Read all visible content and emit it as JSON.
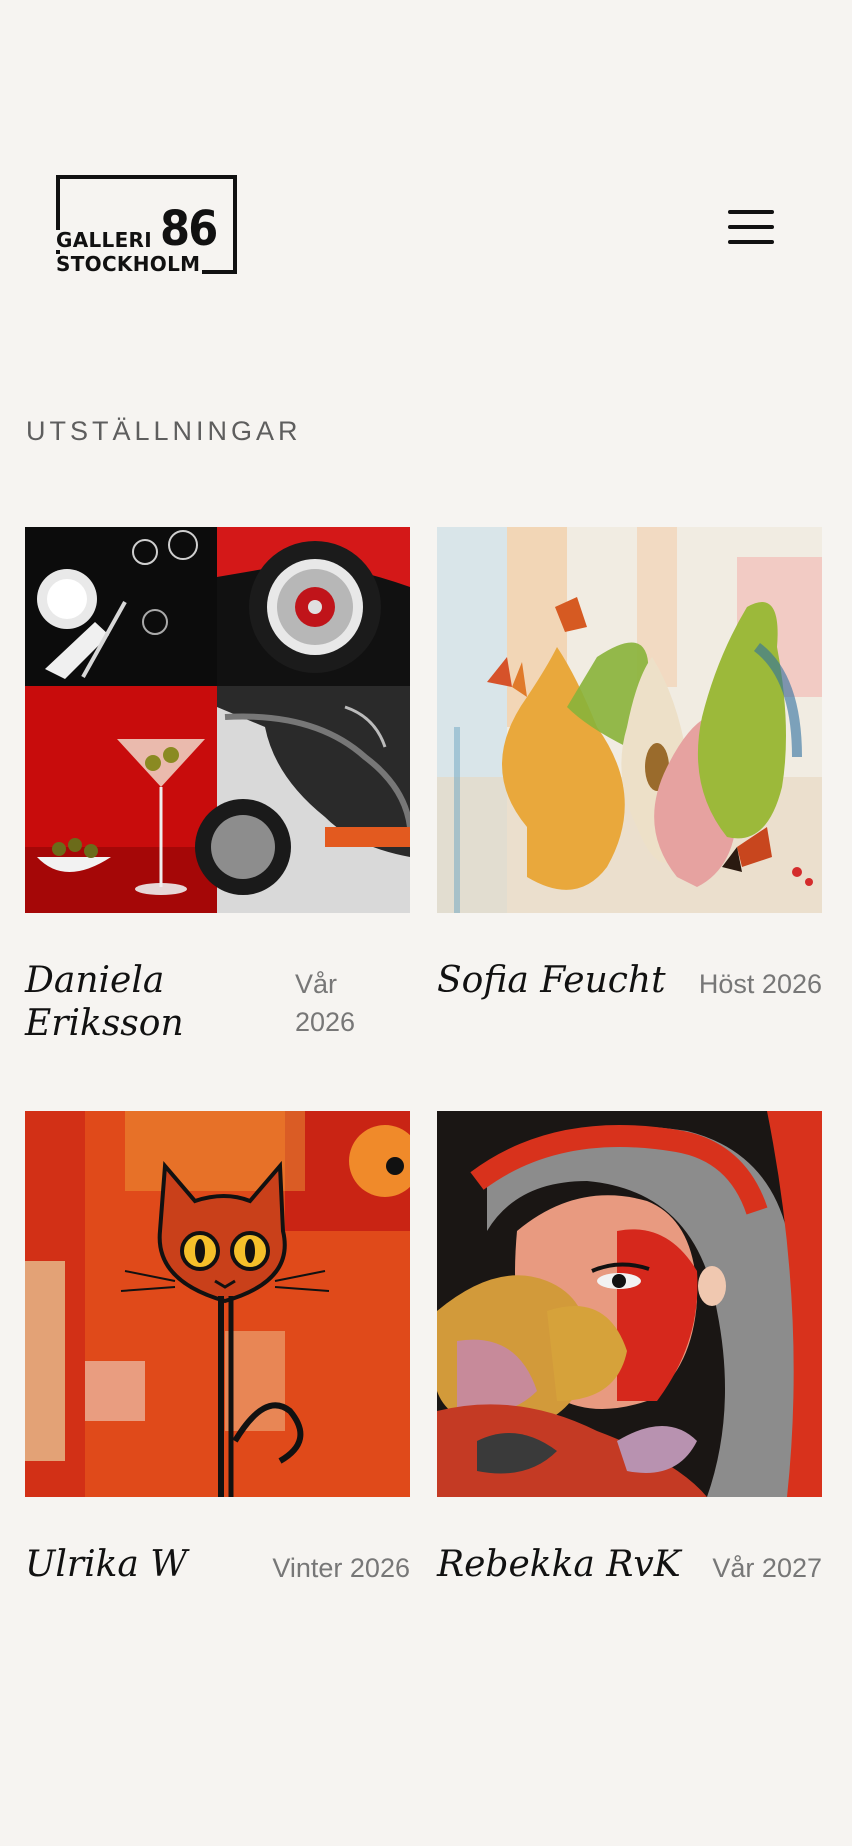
{
  "header": {
    "logo_word1": "GALLERI",
    "logo_word2": "STOCKHOLM",
    "logo_number": "86"
  },
  "section": {
    "title": "UTSTÄLLNINGAR"
  },
  "exhibitions": [
    {
      "artist": "Daniela Eriksson",
      "season": "Vår 2026"
    },
    {
      "artist": "Sofia Feucht",
      "season": "Höst 2026"
    },
    {
      "artist": "Ulrika W",
      "season": "Vinter 2026"
    },
    {
      "artist": "Rebekka RvK",
      "season": "Vår 2027"
    }
  ],
  "colors": {
    "background": "#f6f4f1",
    "text": "#111111",
    "muted": "#777777"
  }
}
